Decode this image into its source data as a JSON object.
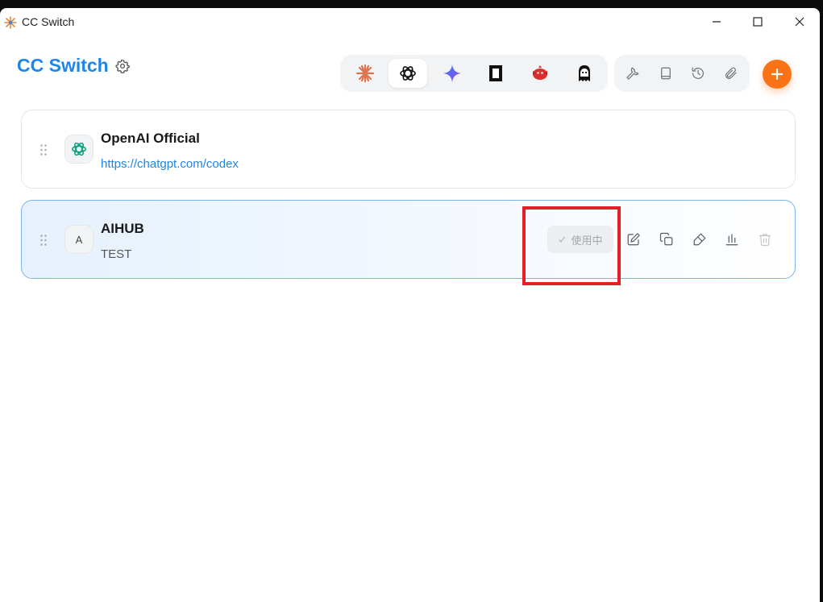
{
  "window": {
    "title": "CC Switch",
    "controls": [
      "minimize",
      "maximize",
      "close"
    ]
  },
  "header": {
    "brand": "CC Switch",
    "settings_icon": "gear-icon",
    "apps": [
      {
        "name": "claude",
        "icon": "claude-starburst-icon",
        "active": false
      },
      {
        "name": "codex",
        "icon": "openai-icon",
        "active": true
      },
      {
        "name": "gemini",
        "icon": "gemini-sparkle-icon",
        "active": false
      },
      {
        "name": "app-4",
        "icon": "black-frame-icon",
        "active": false
      },
      {
        "name": "app-5",
        "icon": "red-bird-icon",
        "active": false
      },
      {
        "name": "app-6",
        "icon": "character-icon",
        "active": false
      }
    ],
    "tools": [
      "wrench-icon",
      "book-icon",
      "history-icon",
      "paperclip-icon"
    ],
    "add_icon": "plus-icon"
  },
  "providers": [
    {
      "name": "OpenAI Official",
      "subtitle": "https://chatgpt.com/codex",
      "avatar_icon": "openai-icon",
      "active": false
    },
    {
      "name": "AIHUB",
      "subtitle": "TEST",
      "avatar_letter": "A",
      "active": true,
      "status_label": "使用中",
      "actions": [
        "edit-icon",
        "copy-icon",
        "test-icon",
        "chart-icon",
        "trash-icon"
      ]
    }
  ],
  "colors": {
    "brand": "#1d86e6",
    "add_button": "#f97316",
    "highlight": "#e3202a",
    "active_border": "#7cb4ec"
  }
}
